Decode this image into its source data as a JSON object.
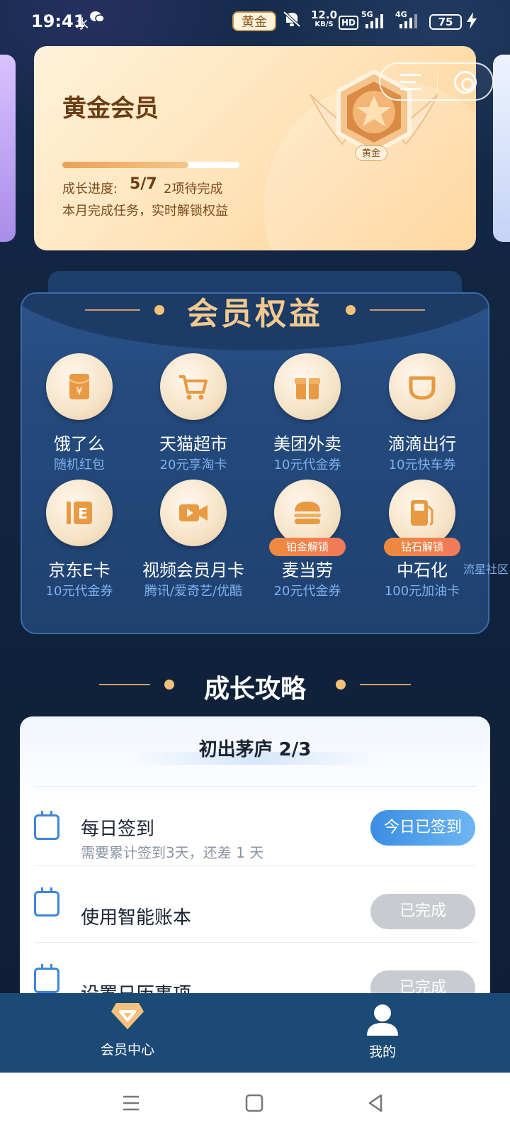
{
  "status_bar": {
    "time": "19:41",
    "extra": "水",
    "level_chip": "黄金",
    "net_speed_value": "12.0",
    "net_speed_unit": "KB/S",
    "hd_label": "HD",
    "net1": "5G",
    "net2": "4G",
    "battery": "75"
  },
  "gold_card": {
    "title": "黄金会员",
    "progress_label": "成长进度:",
    "progress_value": "5/7",
    "progress_fraction": 0.71,
    "pending": "2项待完成",
    "subtitle": "本月完成任务，实时解锁权益",
    "badge_label": "黄金"
  },
  "benefits": {
    "heading": "会员权益",
    "items": [
      {
        "name": "饿了么",
        "sub": "随机红包",
        "icon": "red-envelope-icon"
      },
      {
        "name": "天猫超市",
        "sub": "20元享淘卡",
        "icon": "shopping-cart-icon"
      },
      {
        "name": "美团外卖",
        "sub": "10元代金券",
        "icon": "gift-box-icon"
      },
      {
        "name": "滴滴出行",
        "sub": "10元快车券",
        "icon": "didi-logo-icon"
      },
      {
        "name": "京东E卡",
        "sub": "10元代金券",
        "icon": "e-card-icon"
      },
      {
        "name": "视频会员月卡",
        "sub": "腾讯/爱奇艺/优酷",
        "icon": "video-camera-icon"
      },
      {
        "name": "麦当劳",
        "sub": "20元代金券",
        "icon": "burger-icon",
        "lock": "铂金解锁"
      },
      {
        "name": "中石化",
        "sub": "100元加油卡",
        "icon": "fuel-pump-icon",
        "lock": "钻石解锁"
      }
    ],
    "side_tag": "流星社区"
  },
  "growth": {
    "heading": "成长攻略",
    "stage_title": "初出茅庐 2/3",
    "tasks": [
      {
        "name": "每日签到",
        "desc": "需要累计签到3天，还差 1 天",
        "button": "今日已签到",
        "state": "active"
      },
      {
        "name": "使用智能账本",
        "desc": "",
        "button": "已完成",
        "state": "done"
      },
      {
        "name": "设置日历事项",
        "desc": "",
        "button": "已完成",
        "state": "done"
      }
    ]
  },
  "bottom_nav": {
    "member_center": "会员中心",
    "mine": "我的"
  },
  "colors": {
    "page_bg": "#0f2038",
    "gold_text": "#6b3d12",
    "benefit_heading": "#f2c98f",
    "accent_blue": "#3b8de3",
    "nav_bg": "#1c4a76"
  }
}
